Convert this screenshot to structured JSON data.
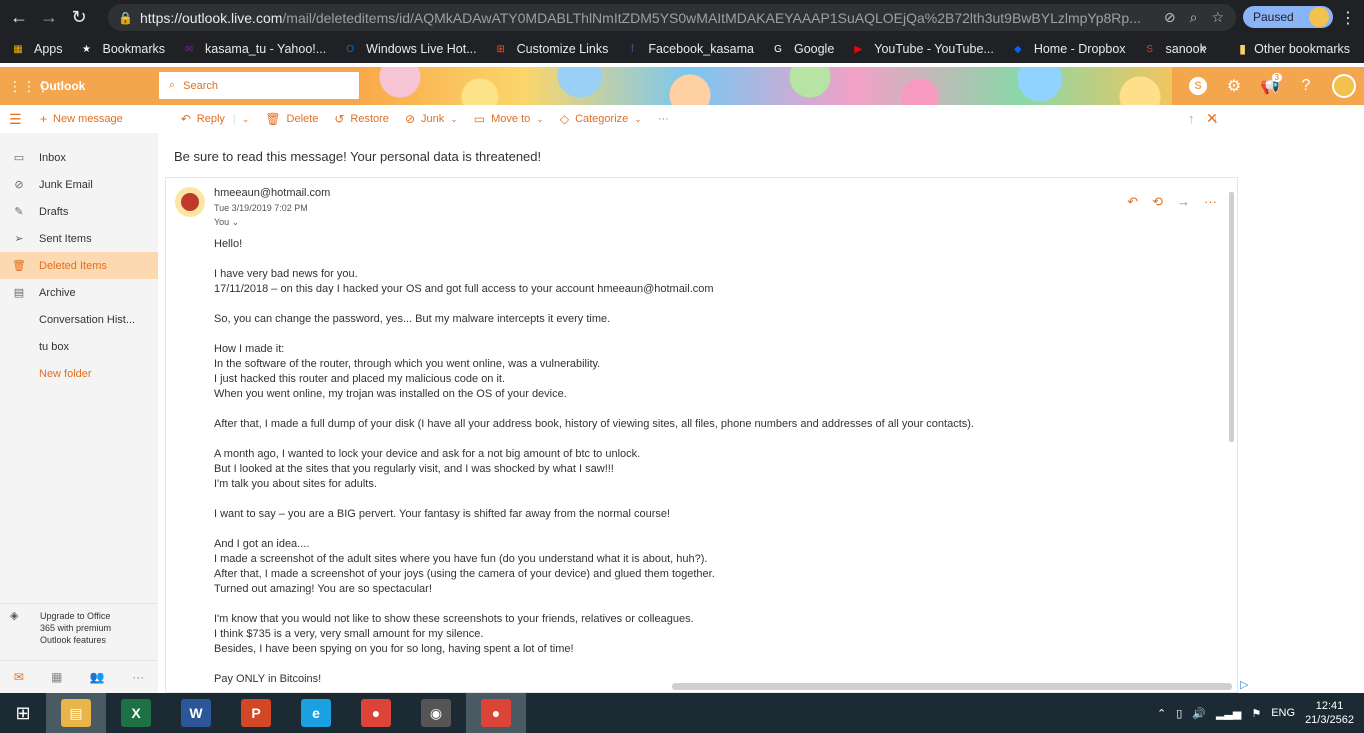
{
  "browser": {
    "url_host": "https://outlook.live.com",
    "url_path": "/mail/deleteditems/id/AQMkADAwATY0MDABLThlNmItZDM5YS0wMAItMDAKAEYAAAP1SuAQLOEjQa%2B72lth3ut9BwBYLzlmpYp8Rp...",
    "paused_label": "Paused"
  },
  "bookmarks": [
    {
      "label": "Apps",
      "icon": "apps-grid-icon",
      "color": "#f4b400"
    },
    {
      "label": "Bookmarks",
      "icon": "star-icon",
      "color": "#ffffff"
    },
    {
      "label": "kasama_tu - Yahoo!...",
      "icon": "yahoo-mail-icon",
      "color": "#7b1fa2"
    },
    {
      "label": "Windows Live Hot...",
      "icon": "outlook-icon",
      "color": "#0072c6"
    },
    {
      "label": "Customize Links",
      "icon": "windows-flag-icon",
      "color": "#f25022"
    },
    {
      "label": "Facebook_kasama",
      "icon": "facebook-icon",
      "color": "#3b5998"
    },
    {
      "label": "Google",
      "icon": "google-icon",
      "color": "#ffffff"
    },
    {
      "label": "YouTube - YouTube...",
      "icon": "youtube-icon",
      "color": "#ff0000"
    },
    {
      "label": "Home - Dropbox",
      "icon": "dropbox-icon",
      "color": "#0061ff"
    },
    {
      "label": "sanook",
      "icon": "sanook-icon",
      "color": "#e53935"
    }
  ],
  "bookmarks_more": "»",
  "bookmarks_other": "Other bookmarks",
  "outlook": {
    "brand": "Outlook",
    "search_placeholder": "Search",
    "notify_count": "3",
    "help": "?"
  },
  "commands": {
    "new_message": "New message",
    "reply": "Reply",
    "delete": "Delete",
    "restore": "Restore",
    "junk": "Junk",
    "move_to": "Move to",
    "categorize": "Categorize",
    "more": "···"
  },
  "folders": [
    {
      "label": "Inbox",
      "icon": "inbox-icon",
      "active": false,
      "link": false
    },
    {
      "label": "Junk Email",
      "icon": "junk-icon",
      "active": false,
      "link": false
    },
    {
      "label": "Drafts",
      "icon": "pencil-icon",
      "active": false,
      "link": false
    },
    {
      "label": "Sent Items",
      "icon": "send-icon",
      "active": false,
      "link": false
    },
    {
      "label": "Deleted Items",
      "icon": "trash-icon",
      "active": true,
      "link": false
    },
    {
      "label": "Archive",
      "icon": "archive-icon",
      "active": false,
      "link": false
    },
    {
      "label": "Conversation Hist...",
      "icon": "",
      "active": false,
      "link": false
    },
    {
      "label": "tu box",
      "icon": "",
      "active": false,
      "link": false
    },
    {
      "label": "New folder",
      "icon": "",
      "active": false,
      "link": true
    }
  ],
  "upgrade": {
    "line1": "Upgrade to Office",
    "line2": "365 with premium",
    "line3": "Outlook features"
  },
  "message": {
    "subject": "Be sure to read this message! Your personal data is threatened!",
    "from": "hmeeaun@hotmail.com",
    "date": "Tue 3/19/2019 7:02 PM",
    "to": "You",
    "body": [
      "Hello!",
      "",
      "I have very bad news for you.",
      "17/11/2018 – on this day I hacked your OS and got full access to your account hmeeaun@hotmail.com",
      "",
      "So, you can change the password, yes... But my malware intercepts it every time.",
      "",
      "How I made it:",
      "In the software of the router, through which you went online, was a vulnerability.",
      "I just hacked this router and placed my malicious code on it.",
      "When you went online, my trojan was installed on the OS of your device.",
      "",
      "After that, I made a full dump of your disk (I have all your address book, history of viewing sites, all files, phone numbers and addresses of all your contacts).",
      "",
      "A month ago, I wanted to lock your device and ask for a not big amount of btc to unlock.",
      "But I looked at the sites that you regularly visit, and I was shocked by what I saw!!!",
      "I'm talk you about sites for adults.",
      "",
      "I want to say – you are a BIG pervert. Your fantasy is shifted far away from the normal course!",
      "",
      "And I got an idea....",
      "I made a screenshot of the adult sites where you have fun (do you understand what it is about, huh?).",
      "After that, I made a screenshot of your joys (using the camera of your device) and glued them together.",
      "Turned out amazing! You are so spectacular!",
      "",
      "I'm know that you would not like to show these screenshots to your friends, relatives or colleagues.",
      "I think $735 is a very, very small amount for my silence.",
      "Besides, I have been spying on you for so long, having spent a lot of time!",
      "",
      "Pay ONLY in Bitcoins!"
    ]
  },
  "taskbar": {
    "apps": [
      {
        "name": "file-explorer",
        "glyph": "▤",
        "color": "#e8b54a",
        "active": true
      },
      {
        "name": "excel",
        "glyph": "X",
        "color": "#1e7145",
        "active": false
      },
      {
        "name": "word",
        "glyph": "W",
        "color": "#2b579a",
        "active": false
      },
      {
        "name": "powerpoint",
        "glyph": "P",
        "color": "#d24726",
        "active": false
      },
      {
        "name": "internet-explorer",
        "glyph": "e",
        "color": "#1ba1e2",
        "active": false
      },
      {
        "name": "chrome",
        "glyph": "●",
        "color": "#db4437",
        "active": false
      },
      {
        "name": "camera",
        "glyph": "◉",
        "color": "#555555",
        "active": false
      },
      {
        "name": "chrome-active",
        "glyph": "●",
        "color": "#db4437",
        "active": true
      }
    ],
    "lang": "ENG",
    "time": "12:41",
    "date": "21/3/2562"
  }
}
